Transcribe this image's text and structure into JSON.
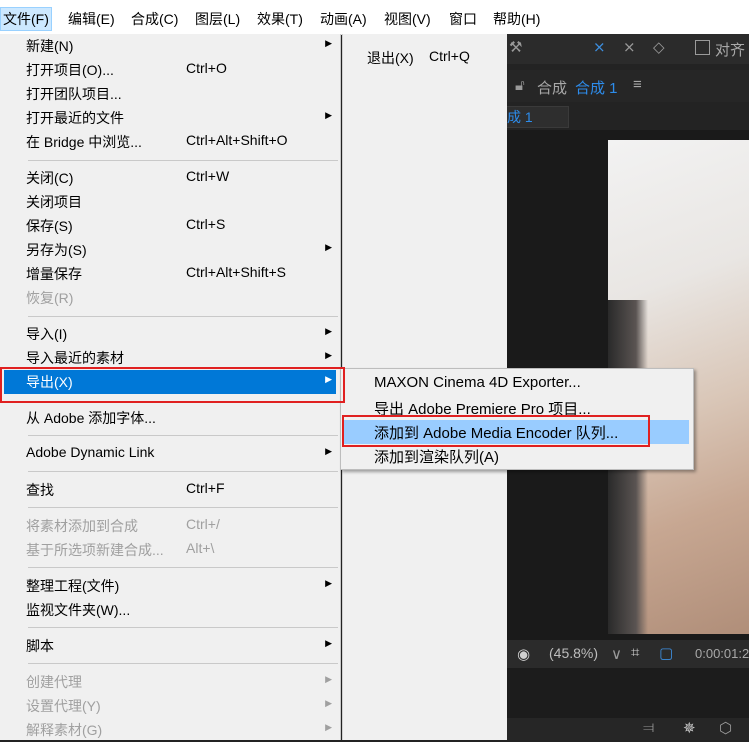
{
  "menubar": {
    "items": [
      {
        "label": "文件(F)",
        "active": true
      },
      {
        "label": "编辑(E)"
      },
      {
        "label": "合成(C)"
      },
      {
        "label": "图层(L)"
      },
      {
        "label": "效果(T)"
      },
      {
        "label": "动画(A)"
      },
      {
        "label": "视图(V)"
      },
      {
        "label": "窗口"
      },
      {
        "label": "帮助(H)"
      }
    ]
  },
  "file_menu": {
    "items": [
      {
        "label": "新建(N)",
        "shortcut": "",
        "submenu": true
      },
      {
        "label": "打开项目(O)...",
        "shortcut": "Ctrl+O"
      },
      {
        "label": "打开团队项目..."
      },
      {
        "label": "打开最近的文件",
        "submenu": true
      },
      {
        "label": "在 Bridge 中浏览...",
        "shortcut": "Ctrl+Alt+Shift+O"
      },
      {
        "label": "关闭(C)",
        "shortcut": "Ctrl+W"
      },
      {
        "label": "关闭项目"
      },
      {
        "label": "保存(S)",
        "shortcut": "Ctrl+S"
      },
      {
        "label": "另存为(S)",
        "submenu": true
      },
      {
        "label": "增量保存",
        "shortcut": "Ctrl+Alt+Shift+S"
      },
      {
        "label": "恢复(R)",
        "disabled": true
      },
      {
        "label": "导入(I)",
        "submenu": true
      },
      {
        "label": "导入最近的素材",
        "submenu": true
      },
      {
        "label": "导出(X)",
        "submenu": true,
        "highlighted": true
      },
      {
        "label": "从 Adobe 添加字体..."
      },
      {
        "label": "Adobe Dynamic Link",
        "submenu": true
      },
      {
        "label": "查找",
        "shortcut": "Ctrl+F"
      },
      {
        "label": "将素材添加到合成",
        "shortcut": "Ctrl+/",
        "disabled": true
      },
      {
        "label": "基于所选项新建合成...",
        "shortcut": "Alt+\\",
        "disabled": true
      },
      {
        "label": "整理工程(文件)",
        "submenu": true
      },
      {
        "label": "监视文件夹(W)..."
      },
      {
        "label": "脚本",
        "submenu": true
      },
      {
        "label": "创建代理",
        "submenu": true,
        "disabled": true
      },
      {
        "label": "设置代理(Y)",
        "submenu": true,
        "disabled": true
      },
      {
        "label": "解释素材(G)",
        "submenu": true,
        "disabled": true
      }
    ]
  },
  "exit_menu": {
    "label": "退出(X)",
    "shortcut": "Ctrl+Q"
  },
  "export_menu": {
    "items": [
      {
        "label": "MAXON Cinema 4D Exporter..."
      },
      {
        "label": "导出 Adobe Premiere Pro 项目..."
      },
      {
        "label": "添加到 Adobe Media Encoder 队列...",
        "highlighted": true
      },
      {
        "label": "添加到渲染队列(A)"
      }
    ]
  },
  "ae": {
    "align_label": "对齐",
    "comp_panel_prefix": "合成",
    "comp_name": "合成 1",
    "comp_tab": "成 1",
    "zoom": "(45.8%)",
    "timecode": "0:00:01:2"
  },
  "colors": {
    "menu_bg": "#f0f0f0",
    "highlight": "#0078d7",
    "submenu_highlight": "#99ccff",
    "annotation": "#e02020",
    "ae_blue": "#2d8ceb"
  }
}
